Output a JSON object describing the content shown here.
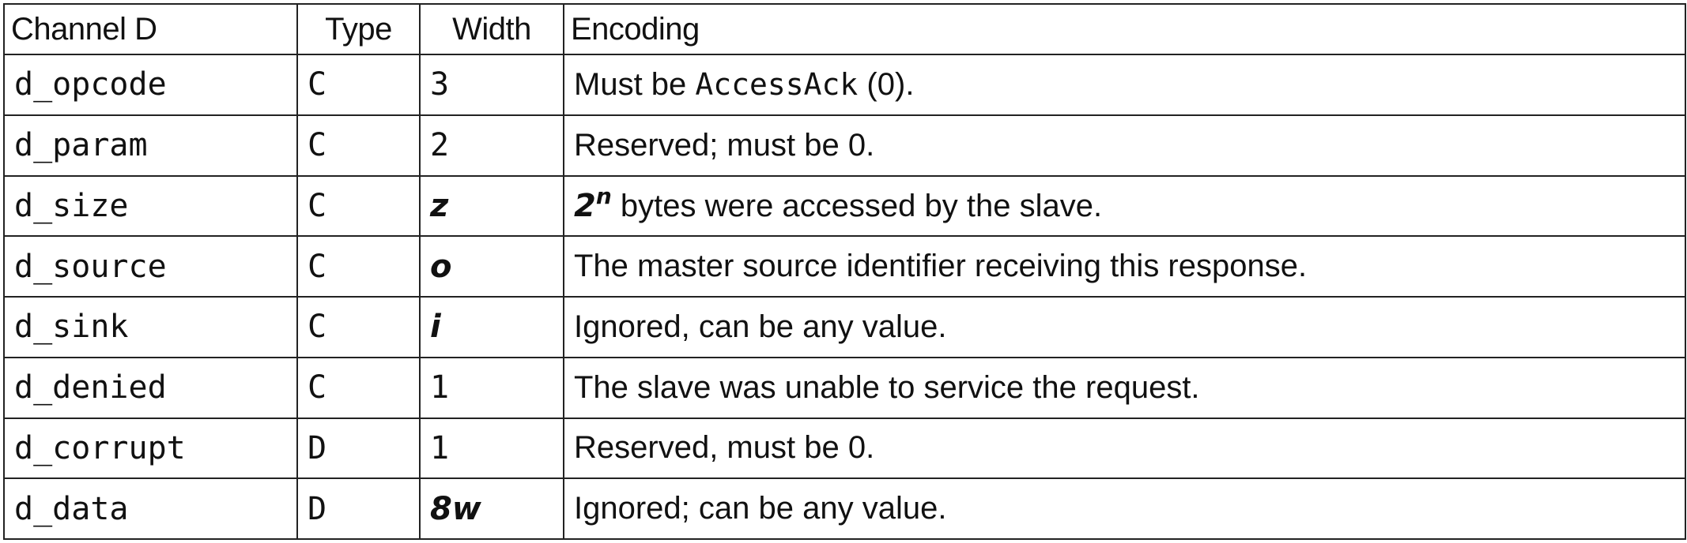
{
  "table": {
    "headers": {
      "channel": "Channel D",
      "type": "Type",
      "width": "Width",
      "encoding": "Encoding"
    },
    "rows": [
      {
        "signal": "d_opcode",
        "type": "C",
        "width": "3",
        "encoding": {
          "before": "Must be ",
          "code": "AccessAck",
          "after": " (0)."
        }
      },
      {
        "signal": "d_param",
        "type": "C",
        "width": "2",
        "encoding": "Reserved; must be 0."
      },
      {
        "signal": "d_size",
        "type": "C",
        "width": "z",
        "encoding": {
          "base": "2",
          "exponent": "n",
          "rest": " bytes were accessed by the slave."
        }
      },
      {
        "signal": "d_source",
        "type": "C",
        "width": "o",
        "encoding": "The master source identifier receiving this response."
      },
      {
        "signal": "d_sink",
        "type": "C",
        "width": "i",
        "encoding": "Ignored, can be any value."
      },
      {
        "signal": "d_denied",
        "type": "C",
        "width": "1",
        "encoding": "The slave was unable to service the request."
      },
      {
        "signal": "d_corrupt",
        "type": "D",
        "width": "1",
        "encoding": "Reserved, must be 0."
      },
      {
        "signal": "d_data",
        "type": "D",
        "width": "8w",
        "encoding": "Ignored; can be any value."
      }
    ]
  }
}
